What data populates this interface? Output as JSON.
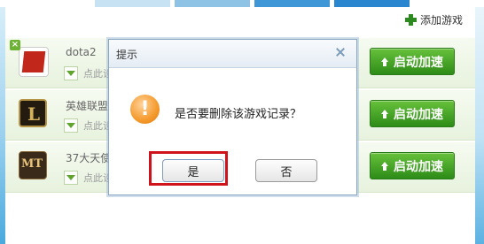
{
  "toolbar": {
    "add_game_label": "添加游戏"
  },
  "games": [
    {
      "name": "dota2",
      "hint": "点此设",
      "start_label": "启动加速",
      "icon": "dota2-logo"
    },
    {
      "name": "英雄联盟",
      "hint": "点此设",
      "start_label": "启动加速",
      "icon": "lol-logo"
    },
    {
      "name": "37大天使",
      "hint": "点此设",
      "start_label": "启动加速",
      "icon": "37-angel-logo"
    }
  ],
  "dialog": {
    "title": "提示",
    "message": "是否要删除该游戏记录？",
    "yes_label": "是",
    "no_label": "否",
    "icon": "warning-icon"
  },
  "colors": {
    "start_button": "#3fa225",
    "highlight": "#d0131a",
    "dialog_border": "#8aa7c3"
  }
}
